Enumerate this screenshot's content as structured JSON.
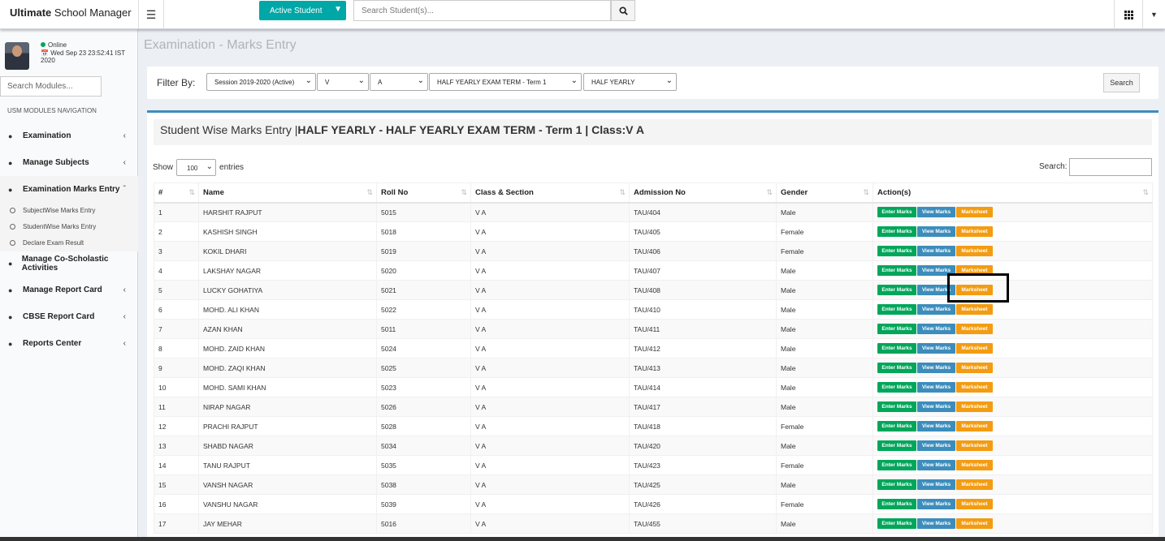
{
  "header": {
    "brand_bold": "Ultimate",
    "brand_rest": " School Manager",
    "active_student_label": "Active Student",
    "search_placeholder": "Search Student(s)..."
  },
  "sidebar": {
    "status": "Online",
    "datetime": "Wed Sep 23 23:52:41 IST 2020",
    "search_placeholder": "Search Modules...",
    "nav_header": "USM MODULES NAVIGATION",
    "items": [
      {
        "label": "Examination"
      },
      {
        "label": "Manage Subjects"
      },
      {
        "label": "Examination Marks Entry"
      },
      {
        "label": "Manage Co-Scholastic Activities"
      },
      {
        "label": "Manage Report Card"
      },
      {
        "label": "CBSE Report Card"
      },
      {
        "label": "Reports Center"
      }
    ],
    "sub_items": [
      {
        "label": "SubjectWise Marks Entry"
      },
      {
        "label": "StudentWise Marks Entry"
      },
      {
        "label": "Declare Exam Result"
      }
    ]
  },
  "page": {
    "title": "Examination - Marks Entry",
    "filter_label": "Filter By:",
    "filters": {
      "session": "Session 2019-2020 (Active)",
      "class": "V",
      "section": "A",
      "exam_term": "HALF YEARLY EXAM TERM - Term 1",
      "exam": "HALF YEARLY"
    },
    "search_button": "Search",
    "box_title_prefix": "Student Wise Marks Entry |",
    "box_title_bold": "HALF YEARLY - HALF YEARLY EXAM TERM - Term 1 | Class:V A",
    "show_label": "Show",
    "entries_value": "100",
    "entries_label": "entries",
    "table_search_label": "Search:"
  },
  "table": {
    "columns": [
      "#",
      "Name",
      "Roll No",
      "Class & Section",
      "Admission No",
      "Gender",
      "Action(s)"
    ],
    "actions": {
      "enter": "Enter Marks",
      "view": "View Marks",
      "marksheet": "Marksheet"
    },
    "rows": [
      [
        "1",
        "HARSHIT RAJPUT",
        "5015",
        "V A",
        "TAU/404",
        "Male"
      ],
      [
        "2",
        "KASHISH SINGH",
        "5018",
        "V A",
        "TAU/405",
        "Female"
      ],
      [
        "3",
        "KOKIL DHARI",
        "5019",
        "V A",
        "TAU/406",
        "Female"
      ],
      [
        "4",
        "LAKSHAY NAGAR",
        "5020",
        "V A",
        "TAU/407",
        "Male"
      ],
      [
        "5",
        "LUCKY GOHATIYA",
        "5021",
        "V A",
        "TAU/408",
        "Male"
      ],
      [
        "6",
        "MOHD. ALI KHAN",
        "5022",
        "V A",
        "TAU/410",
        "Male"
      ],
      [
        "7",
        "AZAN KHAN",
        "5011",
        "V A",
        "TAU/411",
        "Male"
      ],
      [
        "8",
        "MOHD. ZAID KHAN",
        "5024",
        "V A",
        "TAU/412",
        "Male"
      ],
      [
        "9",
        "MOHD. ZAQI KHAN",
        "5025",
        "V A",
        "TAU/413",
        "Male"
      ],
      [
        "10",
        "MOHD. SAMI KHAN",
        "5023",
        "V A",
        "TAU/414",
        "Male"
      ],
      [
        "11",
        "NIRAP NAGAR",
        "5026",
        "V A",
        "TAU/417",
        "Male"
      ],
      [
        "12",
        "PRACHI RAJPUT",
        "5028",
        "V A",
        "TAU/418",
        "Female"
      ],
      [
        "13",
        "SHABD NAGAR",
        "5034",
        "V A",
        "TAU/420",
        "Male"
      ],
      [
        "14",
        "TANU RAJPUT",
        "5035",
        "V A",
        "TAU/423",
        "Female"
      ],
      [
        "15",
        "VANSH NAGAR",
        "5038",
        "V A",
        "TAU/425",
        "Male"
      ],
      [
        "16",
        "VANSHU NAGAR",
        "5039",
        "V A",
        "TAU/426",
        "Female"
      ],
      [
        "17",
        "JAY MEHAR",
        "5016",
        "V A",
        "TAU/455",
        "Male"
      ]
    ]
  }
}
